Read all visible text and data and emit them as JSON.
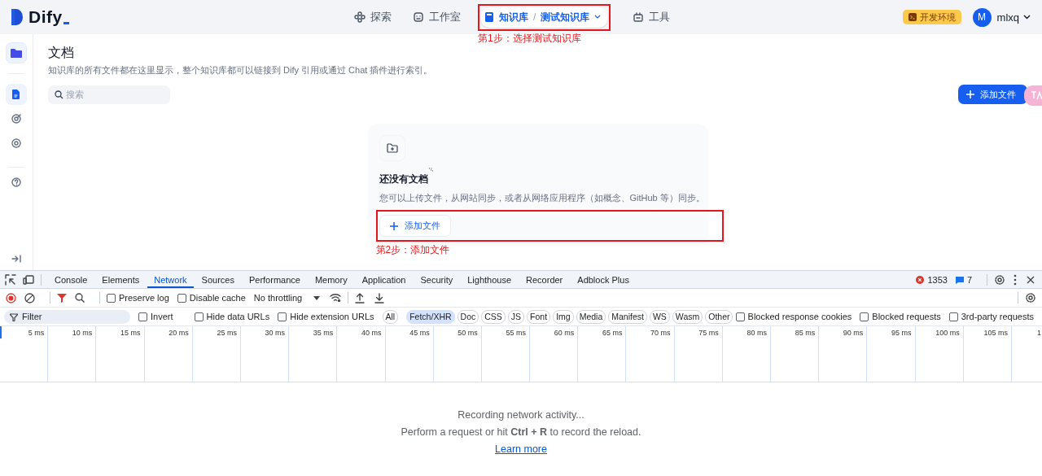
{
  "header": {
    "logo": "Dify",
    "nav": [
      {
        "label": "探索",
        "selected": false
      },
      {
        "label": "工作室",
        "selected": false
      },
      {
        "label": "知识库",
        "separator": "/",
        "current": "测试知识库",
        "selected": true
      },
      {
        "label": "工具",
        "selected": false
      }
    ],
    "nav_annotation": "第1步：选择测试知识库",
    "env_badge": "开发环境",
    "user": {
      "initial": "M",
      "name": "mlxq"
    }
  },
  "sidebar": {
    "items": [
      {
        "selected": true
      },
      {
        "selected": false
      },
      {
        "selected": false
      }
    ]
  },
  "main": {
    "title": "文档",
    "description": "知识库的所有文件都在这里显示，整个知识库都可以链接到 Dify 引用或通过 Chat 插件进行索引。",
    "search": {
      "placeholder": "搜索"
    },
    "add_button": "添加文件",
    "empty_state": {
      "title": "还没有文档",
      "description": "您可以上传文件，从网站同步，或者从网络应用程序（如概念、GitHub 等）同步。",
      "add_button": "添加文件",
      "annotation": "第2步：添加文件"
    }
  },
  "devtools": {
    "tabs": [
      {
        "label": "Console",
        "selected": false
      },
      {
        "label": "Elements",
        "selected": false
      },
      {
        "label": "Network",
        "selected": true
      },
      {
        "label": "Sources",
        "selected": false
      },
      {
        "label": "Performance",
        "selected": false
      },
      {
        "label": "Memory",
        "selected": false
      },
      {
        "label": "Application",
        "selected": false
      },
      {
        "label": "Security",
        "selected": false
      },
      {
        "label": "Lighthouse",
        "selected": false
      },
      {
        "label": "Recorder",
        "selected": false
      },
      {
        "label": "Adblock Plus",
        "selected": false
      }
    ],
    "errors": "1353",
    "messages": "7",
    "toolbar": {
      "recording": true,
      "options": [
        {
          "label": "Preserve log",
          "checked": false
        },
        {
          "label": "Disable cache",
          "checked": false
        }
      ],
      "throttling": "No throttling"
    },
    "filter": {
      "placeholder": "Filter",
      "options": [
        {
          "label": "Invert",
          "checked": false
        },
        {
          "label": "Hide data URLs",
          "checked": false
        },
        {
          "label": "Hide extension URLs",
          "checked": false
        }
      ],
      "types": [
        {
          "label": "All",
          "selected": false
        },
        {
          "label": "Fetch/XHR",
          "selected": true
        },
        {
          "label": "Doc",
          "selected": false
        },
        {
          "label": "CSS",
          "selected": false
        },
        {
          "label": "JS",
          "selected": false
        },
        {
          "label": "Font",
          "selected": false
        },
        {
          "label": "Img",
          "selected": false
        },
        {
          "label": "Media",
          "selected": false
        },
        {
          "label": "Manifest",
          "selected": false
        },
        {
          "label": "WS",
          "selected": false
        },
        {
          "label": "Wasm",
          "selected": false
        },
        {
          "label": "Other",
          "selected": false
        }
      ],
      "more_options": [
        {
          "label": "Blocked response cookies",
          "checked": false
        },
        {
          "label": "Blocked requests",
          "checked": false
        },
        {
          "label": "3rd-party requests",
          "checked": false
        }
      ]
    },
    "timeline": [
      "5 ms",
      "10 ms",
      "15 ms",
      "20 ms",
      "25 ms",
      "30 ms",
      "35 ms",
      "40 ms",
      "45 ms",
      "50 ms",
      "55 ms",
      "60 ms",
      "65 ms",
      "70 ms",
      "75 ms",
      "80 ms",
      "85 ms",
      "90 ms",
      "95 ms",
      "100 ms",
      "105 ms",
      "1"
    ],
    "empty": {
      "status": "Recording network activity...",
      "hint": "Perform a request or hit **Ctrl + R** to record the reload.",
      "link": "Learn more"
    }
  }
}
